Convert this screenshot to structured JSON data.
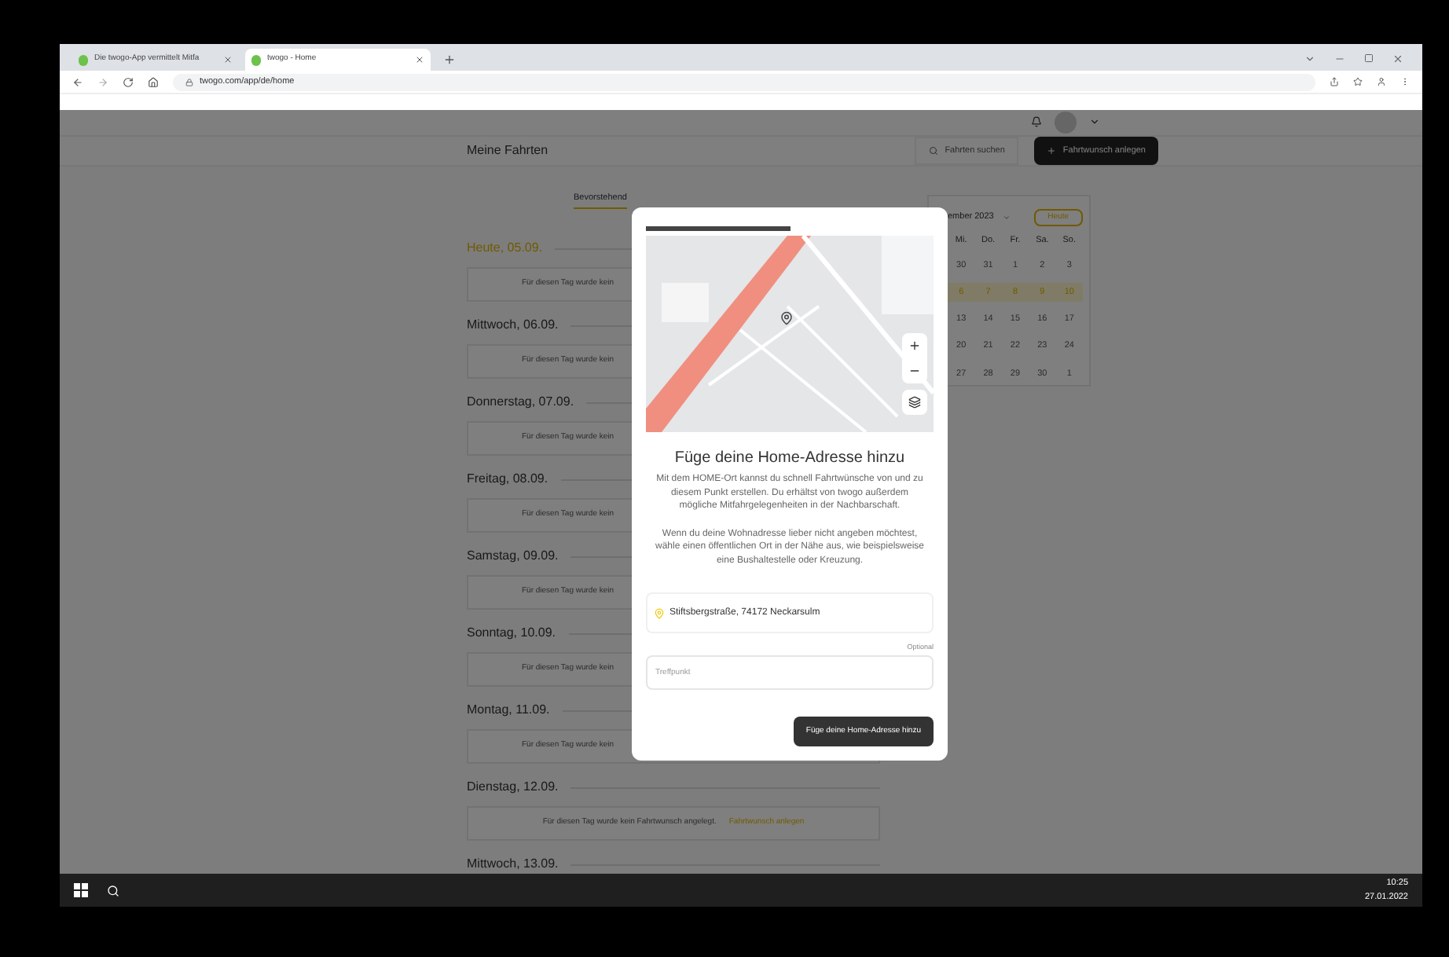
{
  "browser": {
    "tabs": [
      {
        "title": "Die twogo-App vermittelt Mitfa",
        "selected": false
      },
      {
        "title": "twogo - Home",
        "selected": true
      }
    ],
    "url": "twogo.com/app/de/home"
  },
  "app": {
    "page_title": "Meine Fahrten",
    "search_button": "Fahrten suchen",
    "create_button": "Fahrtwunsch anlegen",
    "filter_tab": "Bevorstehend",
    "days": [
      {
        "label": "Heute, 05.09.",
        "today": true,
        "message": "Für diesen Tag wurde kein"
      },
      {
        "label": "Mittwoch, 06.09.",
        "today": false,
        "message": "Für diesen Tag wurde kein"
      },
      {
        "label": "Donnerstag, 07.09.",
        "today": false,
        "message": "Für diesen Tag wurde kein"
      },
      {
        "label": "Freitag, 08.09.",
        "today": false,
        "message": "Für diesen Tag wurde kein"
      },
      {
        "label": "Samstag, 09.09.",
        "today": false,
        "message": "Für diesen Tag wurde kein"
      },
      {
        "label": "Sonntag, 10.09.",
        "today": false,
        "message": "Für diesen Tag wurde kein"
      },
      {
        "label": "Montag, 11.09.",
        "today": false,
        "message": "Für diesen Tag wurde kein"
      },
      {
        "label": "Dienstag, 12.09.",
        "today": false,
        "message": "Für diesen Tag wurde kein Fahrtwunsch angelegt.",
        "link": "Fahrtwunsch anlegen"
      },
      {
        "label": "Mittwoch, 13.09.",
        "today": false
      }
    ],
    "calendar": {
      "month": "ember 2023",
      "today_button": "Heute",
      "weekdays": [
        "Mi.",
        "Do.",
        "Fr.",
        "Sa.",
        "So."
      ],
      "weeks": [
        {
          "days": [
            "30",
            "31",
            "1",
            "2",
            "3"
          ],
          "selected": false
        },
        {
          "days": [
            "6",
            "7",
            "8",
            "9",
            "10"
          ],
          "selected": true
        },
        {
          "days": [
            "13",
            "14",
            "15",
            "16",
            "17"
          ],
          "selected": false
        },
        {
          "days": [
            "20",
            "21",
            "22",
            "23",
            "24"
          ],
          "selected": false
        },
        {
          "days": [
            "27",
            "28",
            "29",
            "30",
            "1"
          ],
          "selected": false
        }
      ]
    }
  },
  "dialog": {
    "progress": {
      "level": 0.5
    },
    "title": "Füge deine Home-Adresse hinzu",
    "paragraphs": [
      "Mit dem HOME-Ort kannst du schnell Fahrtwünsche von und zu diesem Punkt erstellen. Du erhältst von twogo außerdem mögliche Mitfahrgelegenheiten in der Nachbarschaft.",
      "Wenn du deine Wohnadresse lieber nicht angeben möchtest, wähle einen öffentlichen Ort in der Nähe aus, wie beispielsweise eine Bushaltestelle oder Kreuzung."
    ],
    "address": "Stiftsbergstraße, 74172 Neckarsulm",
    "meeting_point": {
      "label": "Optional",
      "placeholder": "Treffpunkt"
    },
    "submit_button": "Füge deine Home-Adresse hinzu"
  },
  "taskbar": {
    "time": "10:25",
    "date": "27.01.2022"
  }
}
